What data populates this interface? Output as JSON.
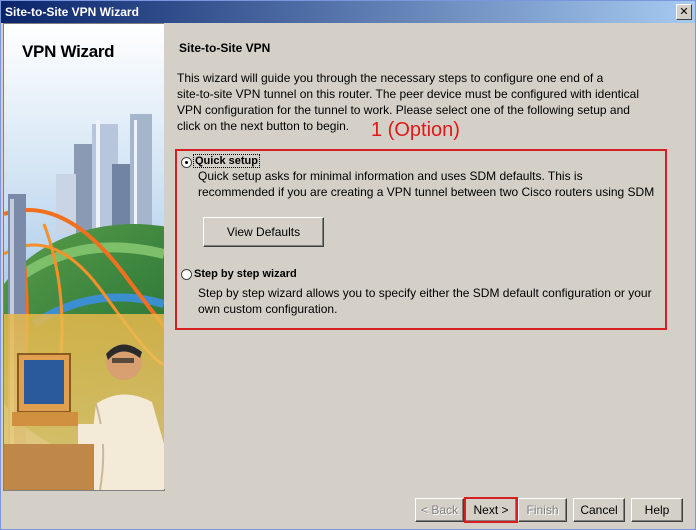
{
  "window": {
    "title": "Site-to-Site VPN Wizard",
    "close_glyph": "✕"
  },
  "side_panel": {
    "title": "VPN Wizard"
  },
  "main": {
    "heading": "Site-to-Site VPN",
    "intro_lines": [
      "This wizard will guide you through the necessary steps to configure one end of a",
      "site-to-site VPN tunnel on this router. The peer device must be configured with identical",
      "VPN configuration for the tunnel to work. Please select one of the following setup and",
      "click on the next button to begin."
    ],
    "annotation": "1 (Option)",
    "options": [
      {
        "label": "Quick setup",
        "selected": true,
        "desc_lines": [
          "Quick setup asks for minimal information and uses SDM defaults. This is",
          "recommended if you are creating a VPN tunnel between two Cisco routers using SDM"
        ],
        "button_label": "View Defaults"
      },
      {
        "label": "Step by step wizard",
        "selected": false,
        "desc_lines": [
          "Step by step wizard allows you to specify either the SDM default configuration or your",
          "own custom configuration."
        ]
      }
    ]
  },
  "footer": {
    "back_label": "< Back",
    "next_label": "Next >",
    "finish_label": "Finish",
    "cancel_label": "Cancel",
    "help_label": "Help"
  },
  "colors": {
    "annotation_red": "#d42020",
    "title_bar_start": "#0a246a",
    "title_bar_end": "#a6caf0"
  }
}
